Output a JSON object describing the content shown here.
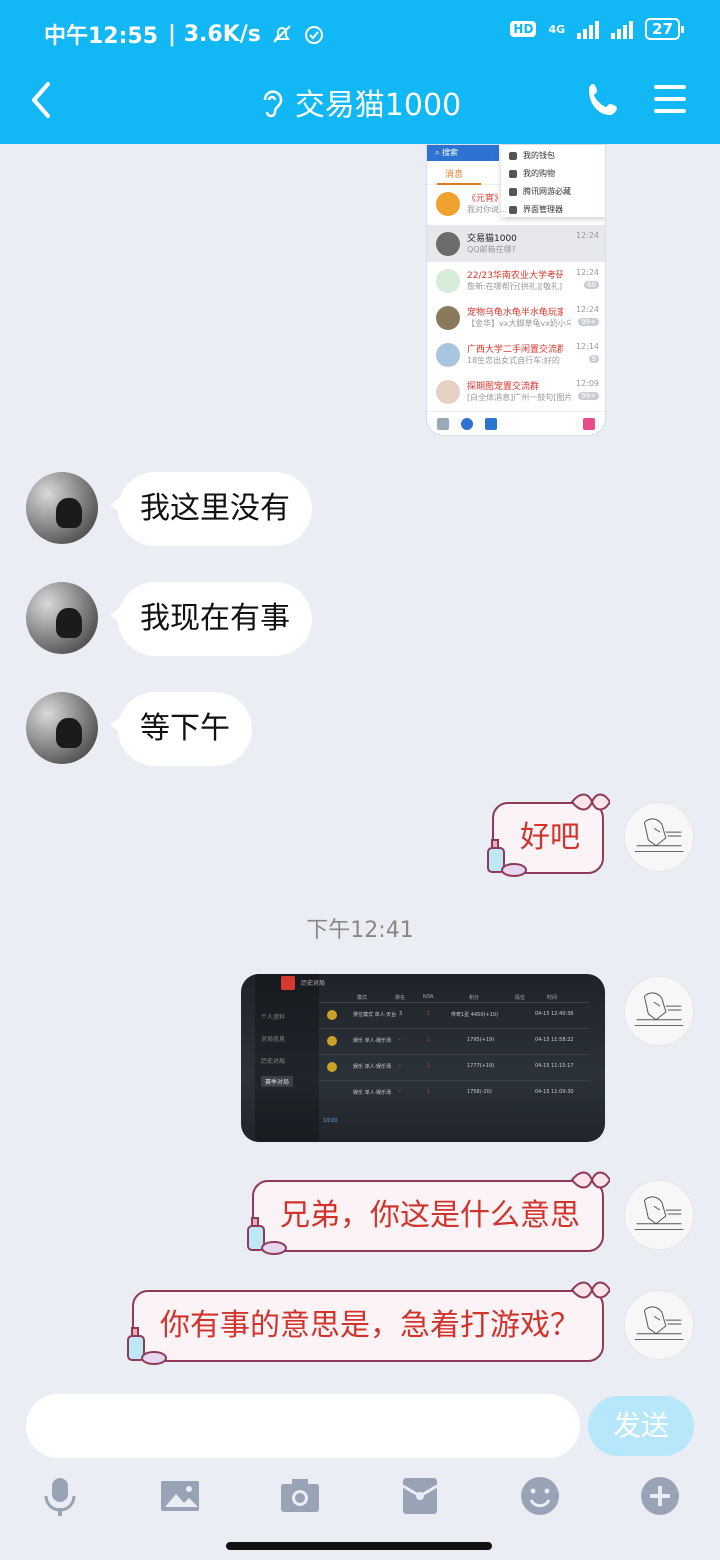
{
  "status_bar": {
    "time": "中午12:55",
    "speed": "| 3.6K/s",
    "hd": "HD",
    "network": "4G",
    "battery": "27"
  },
  "header": {
    "title": "交易猫1000"
  },
  "screenshot_1": {
    "search": "搜索",
    "tab": "消息",
    "menu_items": [
      "我的钱包",
      "我的购物",
      "腾讯网游必藏",
      "界面管理器"
    ],
    "rows": [
      {
        "name": "《元宵》",
        "sub": "我对你说…",
        "time": "",
        "count": ""
      },
      {
        "name": "交易猫1000",
        "sub": "QQ邮箱在哪?",
        "time": "12:24",
        "count": ""
      },
      {
        "name": "22/23华南农业大学考研",
        "sub": "詹新:在哪帮行[拱礼][敬礼]",
        "time": "12:24",
        "count": "60"
      },
      {
        "name": "宠物乌龟水龟半水龟玩家交",
        "sub": "【金华】vx大脚草龟vx奶小乌",
        "time": "12:24",
        "count": "99+"
      },
      {
        "name": "广西大学二手闲置交流群",
        "sub": "18生恋出女式自行车:好的",
        "time": "12:14",
        "count": "9"
      },
      {
        "name": "探期图宠置交流群",
        "sub": "[白全体消息]广州一鼓句[图片]",
        "time": "12:09",
        "count": "99+"
      }
    ]
  },
  "messages": {
    "incoming": [
      "我这里没有",
      "我现在有事",
      "等下午"
    ],
    "outgoing_1": "好吧",
    "timestamp": "下午12:41",
    "outgoing_2": "兄弟，你这是什么意思",
    "outgoing_3": "你有事的意思是，急着打游戏？"
  },
  "screenshot_2": {
    "header": "历史对局",
    "nav": [
      "个人资料",
      "对局信息",
      "历史对局",
      "赛季对局"
    ],
    "columns": [
      "模式",
      "排名",
      "KDA",
      "积分",
      "段位",
      "时间"
    ],
    "rows": [
      {
        "mode": "排位模式 单人·天台",
        "rank": "3",
        "kda": "1",
        "score": "传奇1星 4450(+10)",
        "time": "04-15 12:40:36"
      },
      {
        "mode": "娱乐 单人·娱乐场",
        "rank": "-",
        "kda": "1",
        "score": "1795(+19)",
        "time": "04-15 11:58:22"
      },
      {
        "mode": "娱乐 单人·娱乐场",
        "rank": "-",
        "kda": "1",
        "score": "1777(+19)",
        "time": "04-15 11:15:17"
      },
      {
        "mode": "娱乐 单人·娱乐场",
        "rank": "-",
        "kda": "1",
        "score": "1758(-20)",
        "time": "04-15 11:09:30"
      }
    ],
    "footer": "10/20"
  },
  "input": {
    "placeholder": "",
    "send_label": "发送"
  },
  "colors": {
    "header_bg": "#12b7f5",
    "chat_bg": "#eaedf4",
    "outgoing_text": "#d0342c",
    "outgoing_border": "#8f3a58",
    "send_btn": "#b7e7fb"
  },
  "icons": {
    "back": "chevron-left-icon",
    "title_ear": "ear-icon",
    "call": "phone-icon",
    "menu": "menu-icon",
    "toolbar": [
      "microphone-icon",
      "image-icon",
      "camera-icon",
      "red-packet-icon",
      "emoji-icon",
      "plus-icon"
    ]
  }
}
